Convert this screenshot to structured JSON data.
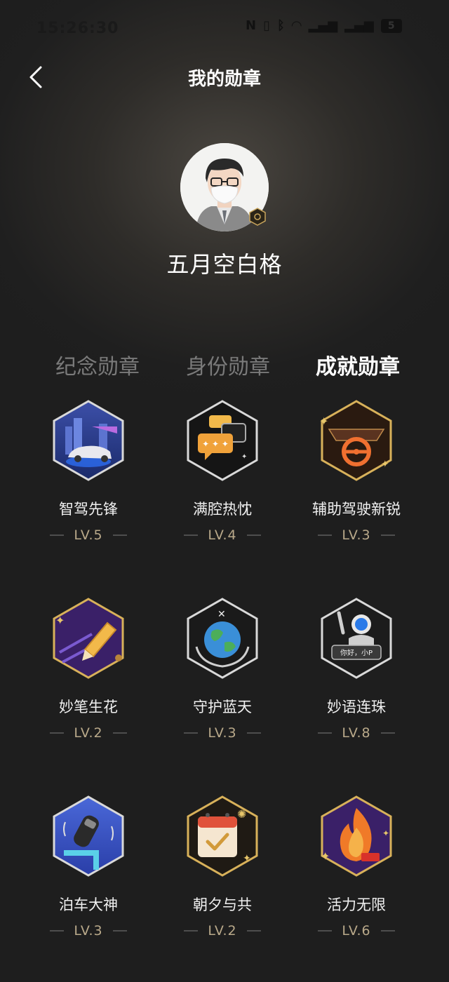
{
  "status_bar": {
    "time": "15:26:30",
    "battery": "5"
  },
  "header": {
    "title": "我的勋章"
  },
  "profile": {
    "name": "五月空白格"
  },
  "tabs": [
    {
      "label": "纪念勋章",
      "active": false
    },
    {
      "label": "身份勋章",
      "active": false
    },
    {
      "label": "成就勋章",
      "active": true
    }
  ],
  "badges": [
    {
      "name": "智驾先锋",
      "level": "LV.5",
      "icon": "smart-driving-car-icon"
    },
    {
      "name": "满腔热忱",
      "level": "LV.4",
      "icon": "chat-bubbles-icon"
    },
    {
      "name": "辅助驾驶新锐",
      "level": "LV.3",
      "icon": "steering-wheel-icon"
    },
    {
      "name": "妙笔生花",
      "level": "LV.2",
      "icon": "pencil-icon"
    },
    {
      "name": "守护蓝天",
      "level": "LV.3",
      "icon": "earth-hands-icon"
    },
    {
      "name": "妙语连珠",
      "level": "LV.8",
      "icon": "robot-greeting-icon",
      "bubble_text": "你好，小P"
    },
    {
      "name": "泊车大神",
      "level": "LV.3",
      "icon": "parking-car-icon"
    },
    {
      "name": "朝夕与共",
      "level": "LV.2",
      "icon": "calendar-check-icon"
    },
    {
      "name": "活力无限",
      "level": "LV.6",
      "icon": "flame-icon"
    }
  ]
}
